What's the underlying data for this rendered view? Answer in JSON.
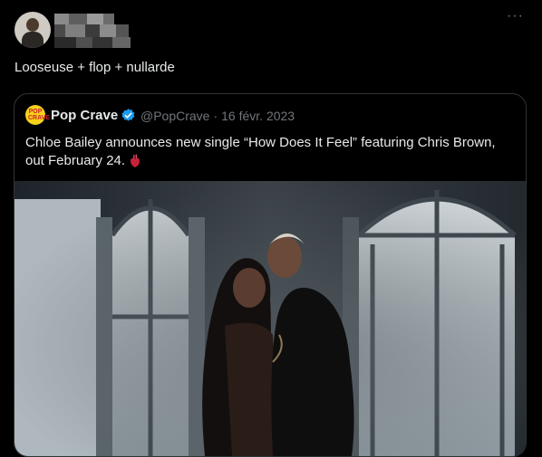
{
  "tweet": {
    "text": "Looseuse + flop + nullarde",
    "more_label": "···"
  },
  "quote": {
    "author_name": "Pop Crave",
    "author_handle": "@PopCrave",
    "separator": "·",
    "date": "16 févr. 2023",
    "avatar_text": "POP CRAVE",
    "text": "Chloe Bailey announces new single “How Does It Feel” featuring Chris Brown, out February 24.",
    "emoji_icon": "anatomical-heart-icon"
  },
  "colors": {
    "background": "#000000",
    "text": "#e7e9ea",
    "muted": "#71767b",
    "verified": "#1d9bf0",
    "border": "#2f3336",
    "popcrave_yellow": "#f5d21a"
  }
}
